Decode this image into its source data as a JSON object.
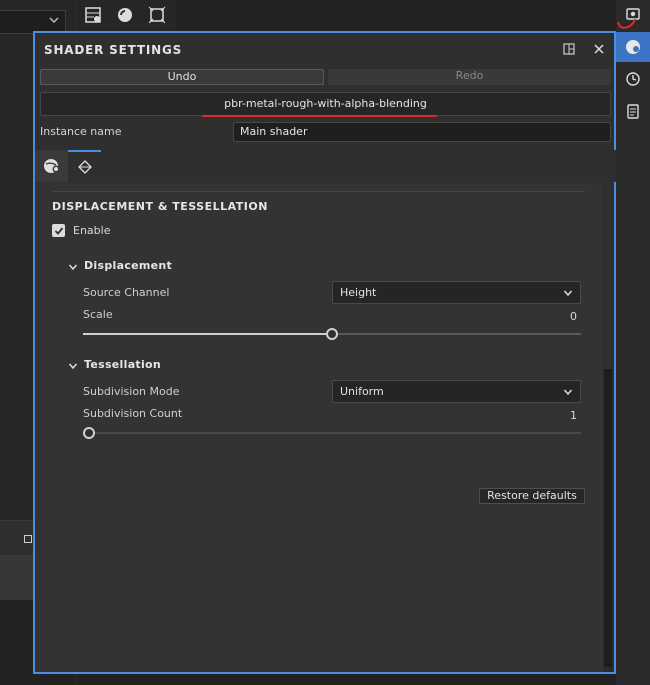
{
  "panel": {
    "title": "SHADER SETTINGS",
    "undo_label": "Undo",
    "redo_label": "Redo",
    "shader_name": "pbr-metal-rough-with-alpha-blending",
    "instance_label": "Instance name",
    "instance_value": "Main shader"
  },
  "section": {
    "title": "DISPLACEMENT & TESSELLATION",
    "enable_label": "Enable",
    "enabled": true
  },
  "displacement": {
    "title": "Displacement",
    "source_label": "Source Channel",
    "source_value": "Height",
    "scale_label": "Scale",
    "scale_value": "0",
    "scale_fraction": 0.5
  },
  "tessellation": {
    "title": "Tessellation",
    "mode_label": "Subdivision Mode",
    "mode_value": "Uniform",
    "count_label": "Subdivision Count",
    "count_value": "1",
    "count_fraction": 0.0
  },
  "restore_label": "Restore defaults",
  "colors": {
    "accent": "#4a90e2",
    "annotation_red": "#e02a2a"
  }
}
